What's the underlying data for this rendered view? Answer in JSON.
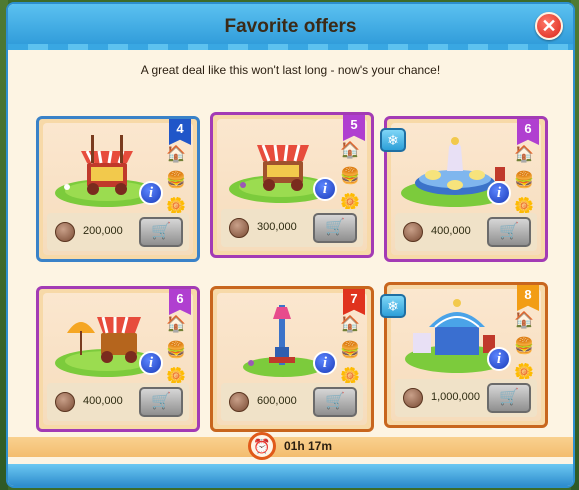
{
  "dialog": {
    "title": "Favorite offers",
    "subtitle": "A great deal like this won't last long - now's your chance!",
    "close_label": "✕"
  },
  "timer": {
    "text": "01h 17m"
  },
  "offers": [
    {
      "badge": "4",
      "price": "200,000"
    },
    {
      "badge": "5",
      "price": "300,000"
    },
    {
      "badge": "6",
      "price": "400,000"
    },
    {
      "badge": "6",
      "price": "400,000"
    },
    {
      "badge": "7",
      "price": "600,000"
    },
    {
      "badge": "8",
      "price": "1,000,000"
    }
  ],
  "icons": {
    "info": "i",
    "cart": "🛒",
    "house": "🏠",
    "burger": "🍔",
    "flower": "🌼",
    "snowflake": "❄",
    "clock": "⏰"
  },
  "colors": {
    "title_bar": "#2e9ad9",
    "badge_blue": "#2056c9",
    "badge_purple": "#b03fd0",
    "badge_red": "#e0331e",
    "badge_orange": "#f29d15"
  }
}
